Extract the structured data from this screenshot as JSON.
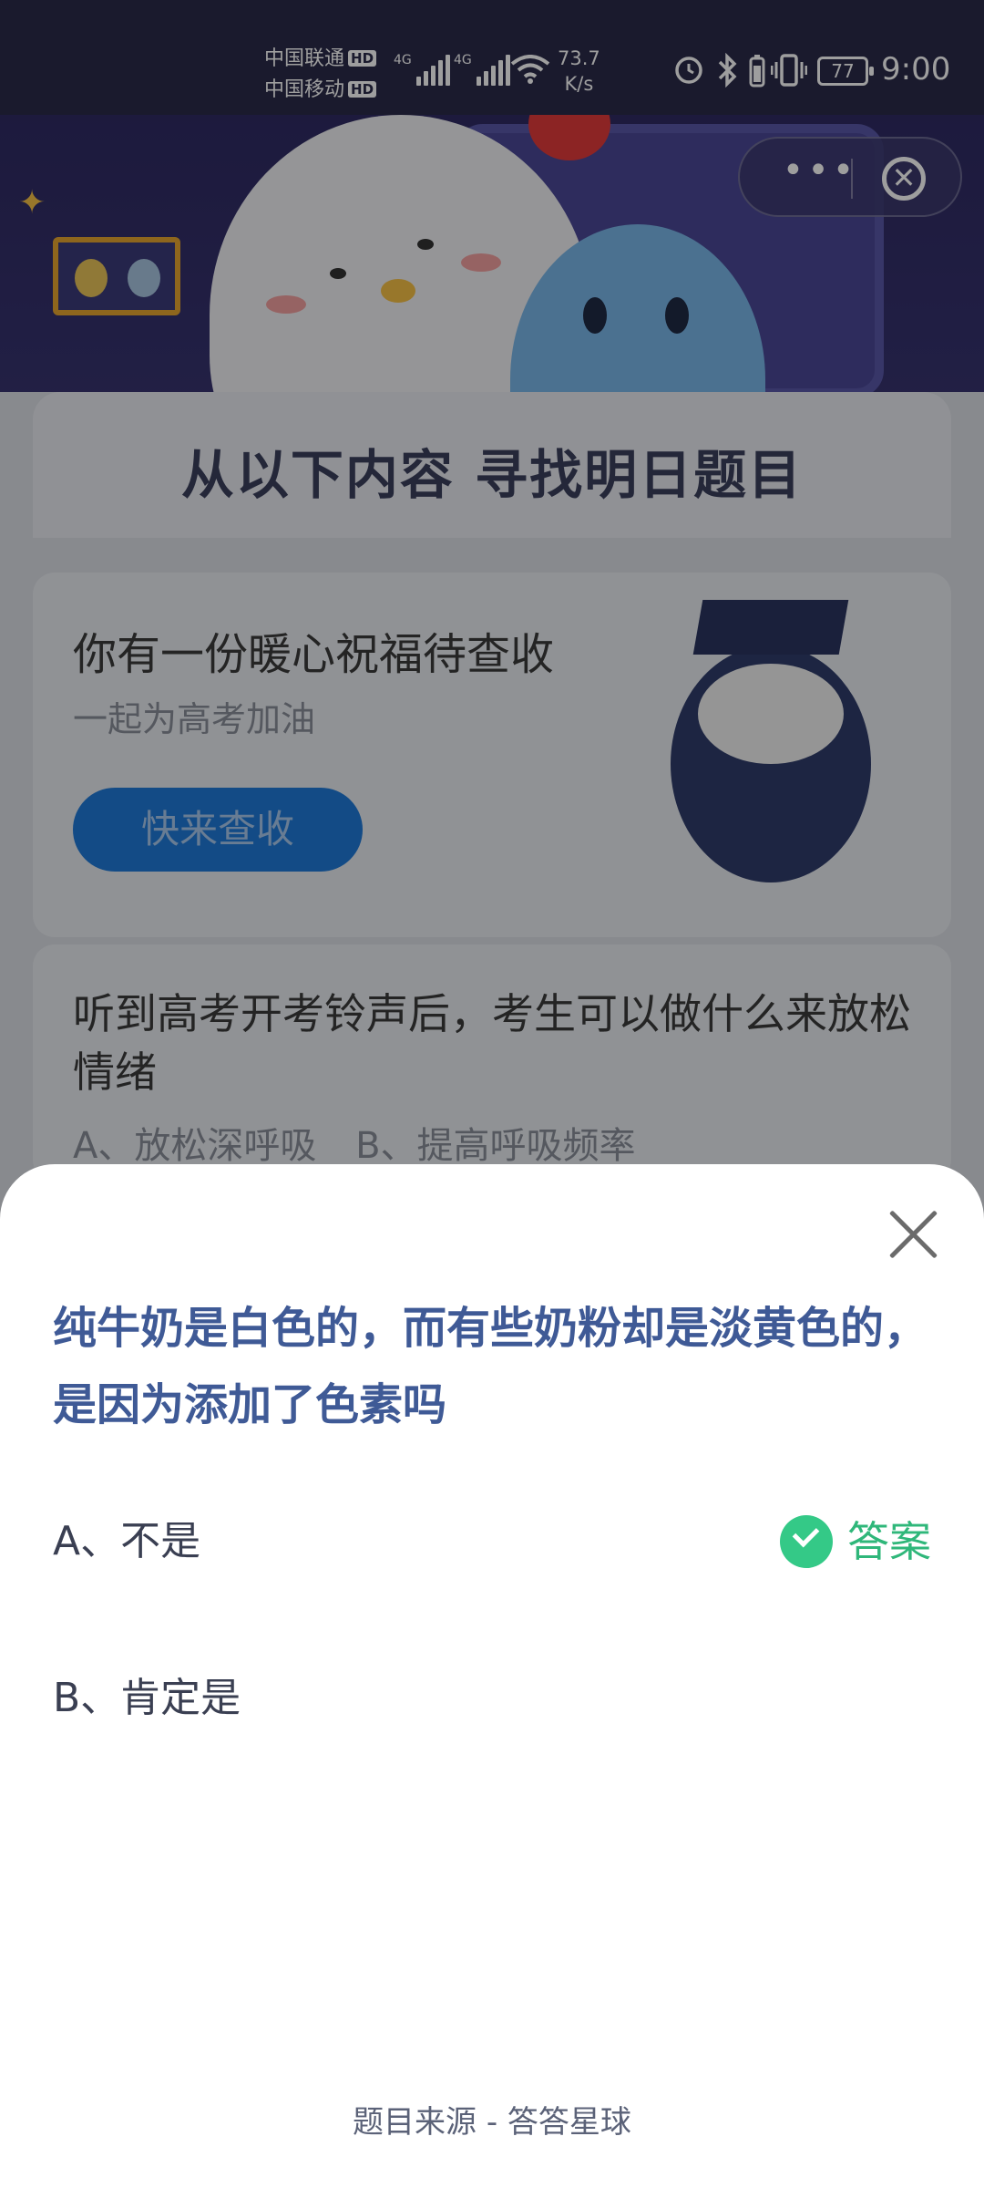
{
  "status_bar": {
    "carrier1": "中国联通",
    "carrier2": "中国移动",
    "hd": "HD",
    "net": "4G",
    "speed_value": "73.7",
    "speed_unit": "K/s",
    "battery": "77",
    "time": "9:00"
  },
  "hero": {
    "more_glyph": "•••",
    "close_glyph": "✕"
  },
  "page": {
    "title": "从以下内容 寻找明日题目",
    "card1_title": "你有一份暖心祝福待查收",
    "card1_subtitle": "一起为高考加油",
    "card1_button": "快来查收",
    "card2_question": "听到高考开考铃声后，考生可以做什么来放松情绪",
    "card2_options": "A、放松深呼吸 B、提高呼吸频率"
  },
  "sheet": {
    "question": "纯牛奶是白色的，而有些奶粉却是淡黄色的，是因为添加了色素吗",
    "option_a": "A、不是",
    "option_b": "B、肯定是",
    "answer_label": "答案",
    "source": "题目来源 - 答答星球"
  },
  "colors": {
    "answer_green": "#34c987",
    "question_blue": "#3f5a96",
    "button_blue": "#1f7ad8"
  }
}
